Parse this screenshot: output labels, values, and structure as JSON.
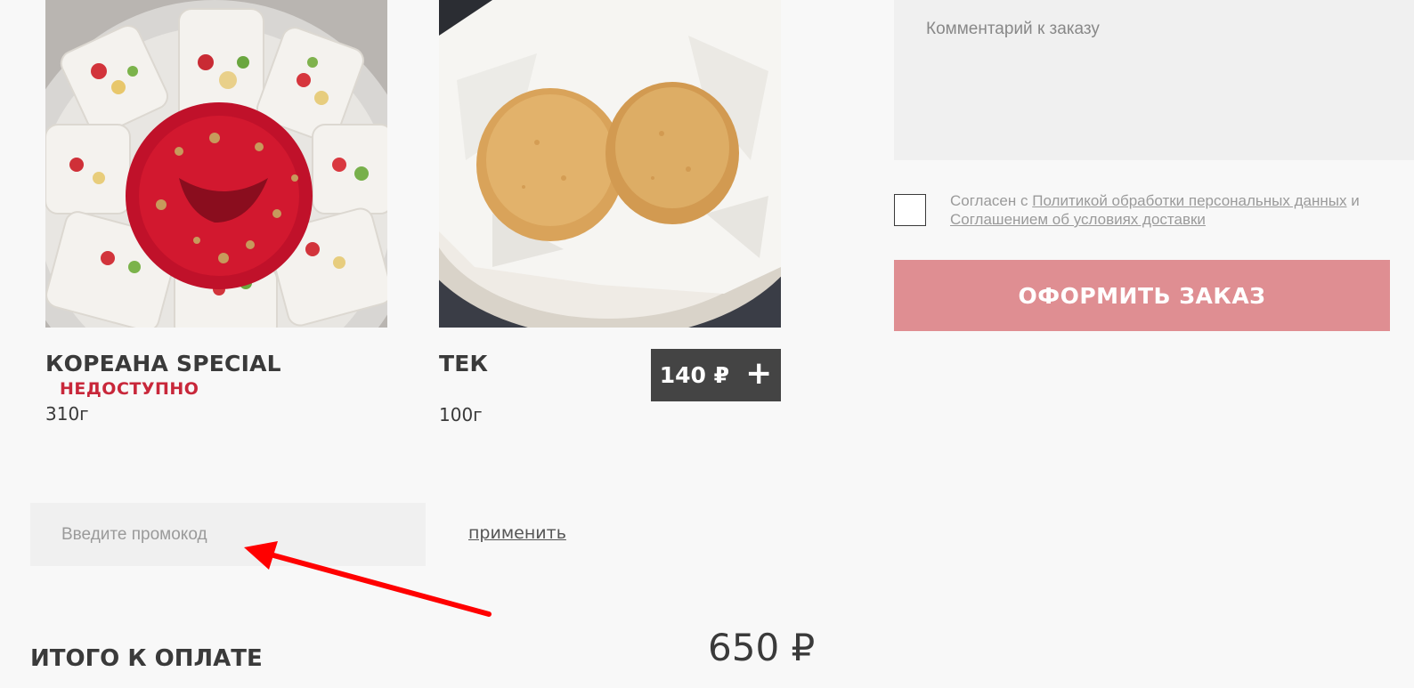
{
  "products": [
    {
      "title": "КОРЕАНА SPECIAL",
      "status": "НЕДОСТУПНО",
      "weight": "310г",
      "image_icon": "dessert-rolls-photo"
    },
    {
      "title": "ТЕК",
      "weight": "100г",
      "price": "140 ₽",
      "add_icon": "+",
      "image_icon": "fried-pies-photo"
    }
  ],
  "promo": {
    "placeholder": "Введите промокод",
    "apply_label": "применить"
  },
  "total": {
    "label": "ИТОГО К ОПЛАТЕ",
    "value": "650 ₽"
  },
  "order_form": {
    "comment_placeholder": "Комментарий к заказу",
    "consent_prefix": "Согласен с",
    "privacy_link": "Политикой обработки персональных данных",
    "consent_and": "и",
    "delivery_link": "Соглашением об условиях доставки",
    "submit_label": "ОФОРМИТЬ ЗАКАЗ"
  },
  "colors": {
    "background": "#f8f8f8",
    "accent_disabled_button": "#df8e92",
    "unavailable_red": "#c8273a",
    "price_button": "#444444",
    "annotation_arrow": "#ff0000"
  }
}
